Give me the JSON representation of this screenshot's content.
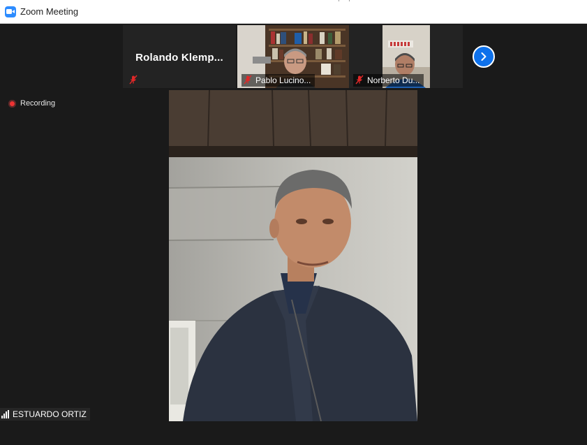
{
  "window": {
    "title": "Zoom Meeting",
    "app_icon": "zoom-camera-icon",
    "brand_color": "#2d8cff"
  },
  "gallery_strip": {
    "participants": [
      {
        "name": "Rolando  Klemp...",
        "video_on": false,
        "muted": true
      },
      {
        "name": "Pablo Lucino...",
        "video_on": true,
        "muted": true
      },
      {
        "name": "Norberto Du...",
        "video_on": true,
        "muted": true
      }
    ],
    "next_button_icon": "chevron-right-icon"
  },
  "recording": {
    "label": "Recording",
    "color": "#e33333"
  },
  "active_speaker": {
    "name": "ESTUARDO ORTIZ",
    "icon": "signal-bars-icon"
  },
  "colors": {
    "background": "#1a1a1a",
    "muted_icon": "#e02828",
    "accent_button": "#0e71eb"
  }
}
